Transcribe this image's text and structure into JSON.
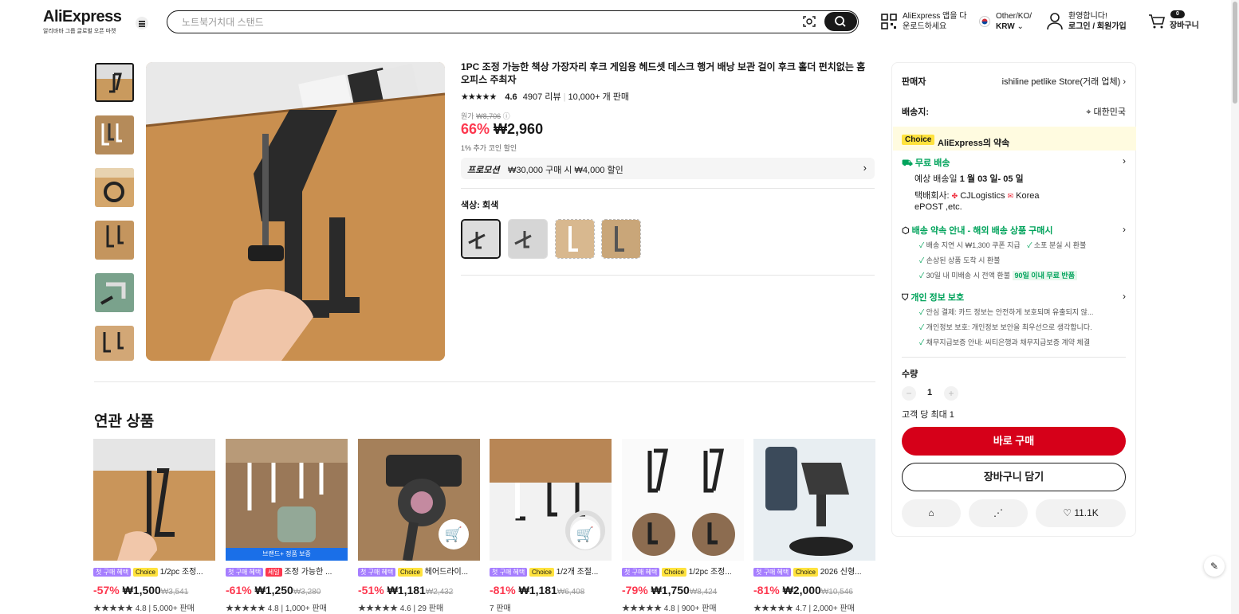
{
  "header": {
    "logo": "AliExpress",
    "logo_sub": "알리바바 그룹 글로벌 오픈 마켓",
    "search_placeholder": "노트북거치대 스탠드",
    "app_line1": "AliExpress 앱을 다",
    "app_line2": "운로드하세요",
    "region_line1": "Other/KO/",
    "region_line2": "KRW",
    "account_line1": "환영합니다!",
    "account_line2": "로그인 / 회원가입",
    "cart_count": "0",
    "cart_label": "장바구니"
  },
  "product": {
    "title": "1PC 조정 가능한 책상 가장자리 후크 게임용 헤드셋 데스크 행거 배낭 보관 걸이 후크 홀더 펀치없는 홈 오피스 주최자",
    "rating": "4.6",
    "reviews": "4907 리뷰",
    "sold": "10,000+ 개 판매",
    "orig_price_label": "원가",
    "orig_price": "₩8,706",
    "discount": "66%",
    "price": "₩2,960",
    "coin_note": "1% 추가 코인 할인",
    "promo_badge": "프로모션",
    "promo_text": "₩30,000 구매 시 ₩4,000 할인",
    "color_label": "색상: 회색"
  },
  "related": {
    "title": "연관 상품",
    "items": [
      {
        "tag1": "첫 구매 혜택",
        "tag2": "Choice",
        "name": "1/2pc 조정...",
        "pct": "-57%",
        "price": "₩1,500",
        "orig": "₩3,541",
        "rating": "4.8",
        "sold": "5,000+ 판매"
      },
      {
        "tag1": "첫 구매 혜택",
        "tag2": "세일",
        "name": "조정 가능한 ...",
        "pct": "-61%",
        "price": "₩1,250",
        "orig": "₩3,280",
        "rating": "4.8",
        "sold": "1,000+ 판매",
        "banner": "브랜드+ 정품 보증"
      },
      {
        "tag1": "첫 구매 혜택",
        "tag2": "Choice",
        "name": "헤어드라이...",
        "pct": "-51%",
        "price": "₩1,181",
        "orig": "₩2,432",
        "rating": "4.6",
        "sold": "29 판매"
      },
      {
        "tag1": "첫 구매 혜택",
        "tag2": "Choice",
        "name": "1/2개 조절...",
        "pct": "-81%",
        "price": "₩1,181",
        "orig": "₩6,408",
        "rating": "",
        "sold": "7 판매"
      },
      {
        "tag1": "첫 구매 혜택",
        "tag2": "Choice",
        "name": "1/2pc 조정...",
        "pct": "-79%",
        "price": "₩1,750",
        "orig": "₩8,424",
        "rating": "4.8",
        "sold": "900+ 판매"
      },
      {
        "tag1": "첫 구매 혜택",
        "tag2": "Choice",
        "name": "2026 신형...",
        "pct": "-81%",
        "price": "₩2,000",
        "orig": "₩10,546",
        "rating": "4.7",
        "sold": "2,000+ 판매"
      }
    ]
  },
  "panel": {
    "seller_label": "판매자",
    "seller_name": "ishiline petlike Store(거래 업체)",
    "ship_to_label": "배송지:",
    "ship_to": "대한민국",
    "choice_chip": "Choice",
    "choice_text": "AliExpress의 약속",
    "free_ship": "무료 배송",
    "eta_prefix": "예상 배송일",
    "eta": "1 월 03 일- 05 일",
    "carrier_label": "택배회사:",
    "carrier1": "CJLogistics",
    "carrier2": "Korea",
    "carrier3": "ePOST ,etc.",
    "promise_title": "배송 약속 안내 - 해외 배송 상품 구매시",
    "promise1": "배송 지연 시 ₩1,300 쿠폰 지급",
    "promise2": "소포 분실 시 환불",
    "promise3": "손상된 상품 도착 시 환불",
    "promise4": "30일 내 미배송 시 전액 환불",
    "promise_badge": "90일 이내 무료 반품",
    "privacy_title": "개인 정보 보호",
    "privacy1": "안심 결제: 카드 정보는 안전하게 보호되며 유출되지 않...",
    "privacy2": "개인정보 보호: 개인정보 보안을 최우선으로 생각합니다.",
    "privacy3": "채무지급보증 안내: 씨티은행과 채무지급보증 계약 체결",
    "qty_label": "수량",
    "qty": "1",
    "qty_limit": "고객 당 최대 1",
    "buy_now": "바로 구매",
    "add_cart": "장바구니 담기",
    "wish_count": "11.1K"
  }
}
